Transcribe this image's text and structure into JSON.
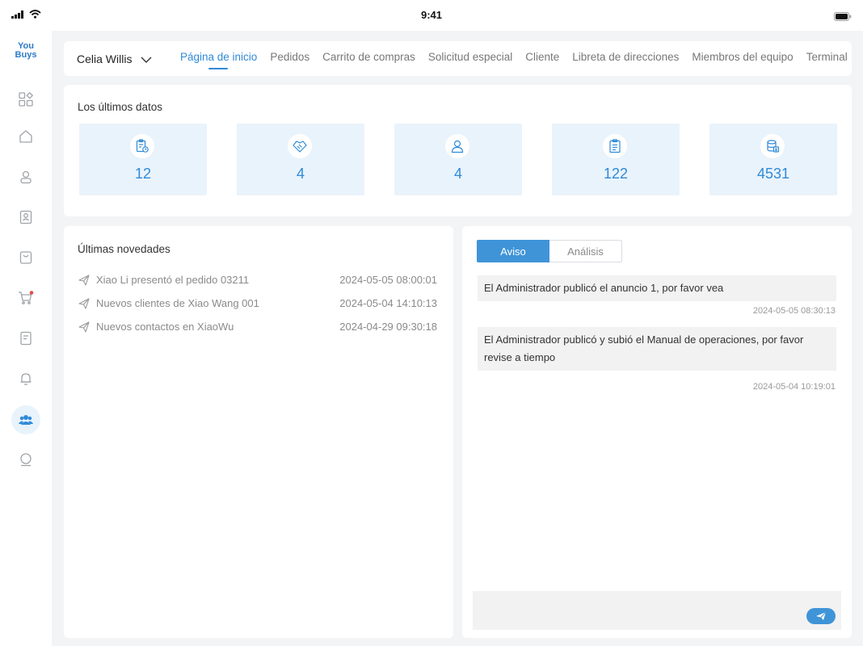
{
  "statusbar": {
    "time": "9:41"
  },
  "app": {
    "logo_line1": "You",
    "logo_line2": "Buys",
    "accent_color": "#2f8ad8",
    "card_bg": "#e9f3fb"
  },
  "sidebar": {
    "items": [
      {
        "icon": "apps-icon"
      },
      {
        "icon": "home-icon"
      },
      {
        "icon": "user-icon"
      },
      {
        "icon": "contacts-icon"
      },
      {
        "icon": "bag-icon"
      },
      {
        "icon": "cart-icon",
        "badge": true
      },
      {
        "icon": "document-icon"
      },
      {
        "icon": "bell-icon"
      },
      {
        "icon": "team-icon",
        "active": true
      },
      {
        "icon": "profile-icon"
      }
    ]
  },
  "header": {
    "user_name": "Celia Willis",
    "tabs": [
      {
        "label": "Página de inicio",
        "active": true
      },
      {
        "label": "Pedidos"
      },
      {
        "label": "Carrito de compras"
      },
      {
        "label": "Solicitud especial"
      },
      {
        "label": "Cliente"
      },
      {
        "label": "Libreta de direcciones"
      },
      {
        "label": "Miembros del equipo"
      },
      {
        "label": "Terminal"
      }
    ]
  },
  "latest_data": {
    "title": "Los últimos datos",
    "stats": [
      {
        "icon": "order-clipboard-icon",
        "value": "12"
      },
      {
        "icon": "handshake-icon",
        "value": "4"
      },
      {
        "icon": "person-icon",
        "value": "4"
      },
      {
        "icon": "list-document-icon",
        "value": "122"
      },
      {
        "icon": "database-icon",
        "value": "4531"
      }
    ]
  },
  "news": {
    "title": "Últimas novedades",
    "items": [
      {
        "text": "Xiao Li presentó el pedido 03211",
        "date": "2024-05-05  08:00:01"
      },
      {
        "text": "Nuevos clientes de Xiao Wang 001",
        "date": "2024-05-04   14:10:13"
      },
      {
        "text": "Nuevos contactos en XiaoWu",
        "date": "2024-04-29  09:30:18"
      }
    ]
  },
  "notices": {
    "tabs": [
      {
        "label": "Aviso",
        "active": true
      },
      {
        "label": "Análisis"
      }
    ],
    "items": [
      {
        "text": "El Administrador publicó el anuncio 1, por favor vea",
        "time": "2024-05-05  08:30:13"
      },
      {
        "text": "El Administrador publicó y subió el Manual de operaciones, por favor revise a tiempo",
        "time": "2024-05-04   10:19:01"
      }
    ]
  }
}
